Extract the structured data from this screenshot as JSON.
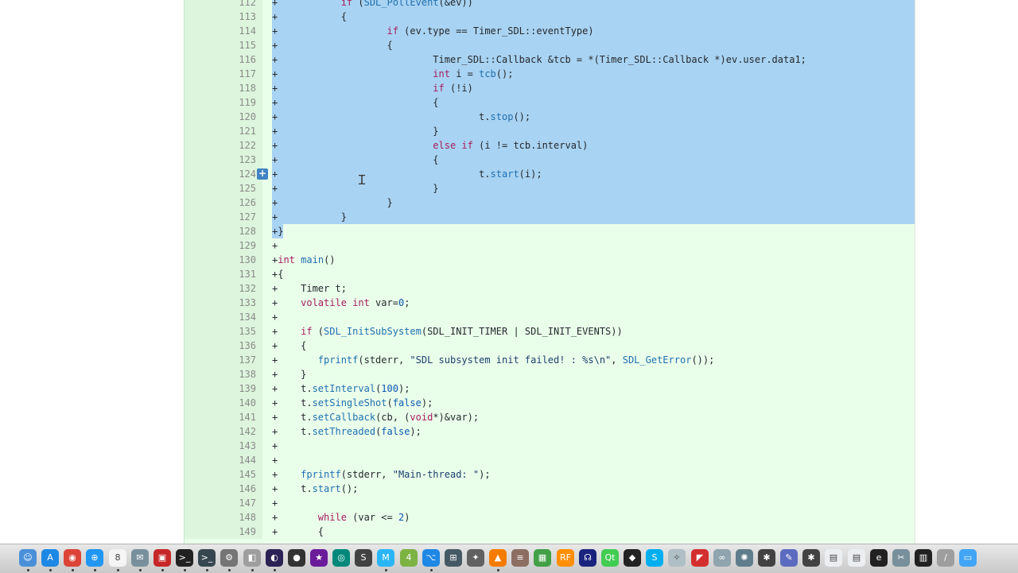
{
  "diff": {
    "lines": [
      {
        "n": "112",
        "sel": true,
        "t": [
          [
            "+           "
          ],
          [
            "if",
            "kw"
          ],
          [
            " ("
          ],
          [
            "SDL_PollEvent",
            "fn"
          ],
          [
            "(&ev))"
          ]
        ]
      },
      {
        "n": "113",
        "sel": true,
        "t": [
          [
            "+           {"
          ]
        ]
      },
      {
        "n": "114",
        "sel": true,
        "t": [
          [
            "+                   "
          ],
          [
            "if",
            "kw"
          ],
          [
            " (ev.type == Timer_SDL::eventType)"
          ]
        ]
      },
      {
        "n": "115",
        "sel": true,
        "t": [
          [
            "+                   {"
          ]
        ]
      },
      {
        "n": "116",
        "sel": true,
        "t": [
          [
            "+                           Timer_SDL::Callback &tcb = *(Timer_SDL::Callback *)ev.user.data1;"
          ]
        ]
      },
      {
        "n": "117",
        "sel": true,
        "t": [
          [
            "+                           "
          ],
          [
            "int",
            "kw"
          ],
          [
            " i = "
          ],
          [
            "tcb",
            "fn"
          ],
          [
            "();"
          ]
        ]
      },
      {
        "n": "118",
        "sel": true,
        "t": [
          [
            "+                           "
          ],
          [
            "if",
            "kw"
          ],
          [
            " (!i)"
          ]
        ]
      },
      {
        "n": "119",
        "sel": true,
        "t": [
          [
            "+                           {"
          ]
        ]
      },
      {
        "n": "120",
        "sel": true,
        "t": [
          [
            "+                                   t."
          ],
          [
            "stop",
            "fn"
          ],
          [
            "();"
          ]
        ]
      },
      {
        "n": "121",
        "sel": true,
        "t": [
          [
            "+                           }"
          ]
        ]
      },
      {
        "n": "122",
        "sel": true,
        "t": [
          [
            "+                           "
          ],
          [
            "else if",
            "kw"
          ],
          [
            " (i != tcb.interval)"
          ]
        ]
      },
      {
        "n": "123",
        "sel": true,
        "t": [
          [
            "+                           {"
          ]
        ]
      },
      {
        "n": "124",
        "sel": true,
        "btn": true,
        "t": [
          [
            "+                                   t."
          ],
          [
            "start",
            "fn"
          ],
          [
            "(i);"
          ]
        ]
      },
      {
        "n": "125",
        "sel": true,
        "t": [
          [
            "+                           }"
          ]
        ]
      },
      {
        "n": "126",
        "sel": true,
        "t": [
          [
            "+                   }"
          ]
        ]
      },
      {
        "n": "127",
        "sel": true,
        "t": [
          [
            "+           }"
          ]
        ]
      },
      {
        "n": "128",
        "partial": true,
        "t": [
          [
            "+}"
          ]
        ]
      },
      {
        "n": "129",
        "t": [
          [
            "+"
          ]
        ]
      },
      {
        "n": "130",
        "t": [
          [
            "+"
          ],
          [
            "int",
            "kw"
          ],
          [
            " "
          ],
          [
            "main",
            "fn"
          ],
          [
            "()"
          ]
        ]
      },
      {
        "n": "131",
        "t": [
          [
            "+{"
          ]
        ]
      },
      {
        "n": "132",
        "t": [
          [
            "+    Timer t;"
          ]
        ]
      },
      {
        "n": "133",
        "t": [
          [
            "+    "
          ],
          [
            "volatile int",
            "kw"
          ],
          [
            " var="
          ],
          [
            "0",
            "num"
          ],
          [
            ";"
          ]
        ]
      },
      {
        "n": "134",
        "t": [
          [
            "+"
          ]
        ]
      },
      {
        "n": "135",
        "t": [
          [
            "+    "
          ],
          [
            "if",
            "kw"
          ],
          [
            " ("
          ],
          [
            "SDL_InitSubSystem",
            "fn"
          ],
          [
            "(SDL_INIT_TIMER | SDL_INIT_EVENTS))"
          ]
        ]
      },
      {
        "n": "136",
        "t": [
          [
            "+    {"
          ]
        ]
      },
      {
        "n": "137",
        "t": [
          [
            "+       "
          ],
          [
            "fprintf",
            "fn"
          ],
          [
            "(stderr, "
          ],
          [
            "\"SDL subsystem init failed! : %s\\n\"",
            "str"
          ],
          [
            ", "
          ],
          [
            "SDL_GetError",
            "fn"
          ],
          [
            "());"
          ]
        ]
      },
      {
        "n": "138",
        "t": [
          [
            "+    }"
          ]
        ]
      },
      {
        "n": "139",
        "t": [
          [
            "+    t."
          ],
          [
            "setInterval",
            "fn"
          ],
          [
            "("
          ],
          [
            "100",
            "num"
          ],
          [
            ");"
          ]
        ]
      },
      {
        "n": "140",
        "t": [
          [
            "+    t."
          ],
          [
            "setSingleShot",
            "fn"
          ],
          [
            "("
          ],
          [
            "false",
            "num"
          ],
          [
            ");"
          ]
        ]
      },
      {
        "n": "141",
        "t": [
          [
            "+    t."
          ],
          [
            "setCallback",
            "fn"
          ],
          [
            "(cb, ("
          ],
          [
            "void",
            "kw"
          ],
          [
            "*)&var);"
          ]
        ]
      },
      {
        "n": "142",
        "t": [
          [
            "+    t."
          ],
          [
            "setThreaded",
            "fn"
          ],
          [
            "("
          ],
          [
            "false",
            "num"
          ],
          [
            ");"
          ]
        ]
      },
      {
        "n": "143",
        "t": [
          [
            "+"
          ]
        ]
      },
      {
        "n": "144",
        "t": [
          [
            "+"
          ]
        ]
      },
      {
        "n": "145",
        "t": [
          [
            "+    "
          ],
          [
            "fprintf",
            "fn"
          ],
          [
            "(stderr, "
          ],
          [
            "\"Main-thread: \"",
            "str"
          ],
          [
            ");"
          ]
        ]
      },
      {
        "n": "146",
        "t": [
          [
            "+    t."
          ],
          [
            "start",
            "fn"
          ],
          [
            "();"
          ]
        ]
      },
      {
        "n": "147",
        "t": [
          [
            "+"
          ]
        ]
      },
      {
        "n": "148",
        "t": [
          [
            "+       "
          ],
          [
            "while",
            "kw"
          ],
          [
            " (var <= "
          ],
          [
            "2",
            "num"
          ],
          [
            ")"
          ]
        ]
      },
      {
        "n": "149",
        "t": [
          [
            "+       {"
          ]
        ]
      }
    ]
  },
  "dock": {
    "apps": [
      {
        "name": "finder",
        "bg": "#4a90d9",
        "glyph": "☺"
      },
      {
        "name": "app-store",
        "bg": "#1e88e5",
        "glyph": "A"
      },
      {
        "name": "chrome",
        "bg": "#db4437",
        "glyph": "◉"
      },
      {
        "name": "safari",
        "bg": "#2196f3",
        "glyph": "⊕"
      },
      {
        "name": "calendar",
        "bg": "#f5f5f5",
        "glyph": "8"
      },
      {
        "name": "mail",
        "bg": "#78909c",
        "glyph": "✉"
      },
      {
        "name": "photo-booth",
        "bg": "#c62828",
        "glyph": "▣"
      },
      {
        "name": "terminal",
        "bg": "#212121",
        "glyph": ">_"
      },
      {
        "name": "terminal-2",
        "bg": "#37474f",
        "glyph": ">_"
      },
      {
        "name": "system-preferences",
        "bg": "#757575",
        "glyph": "⚙"
      },
      {
        "name": "preview",
        "bg": "#9e9e9e",
        "glyph": "◧"
      },
      {
        "name": "eclipse",
        "bg": "#2c2255",
        "glyph": "◐"
      },
      {
        "name": "github",
        "bg": "#333333",
        "glyph": "●"
      },
      {
        "name": "imovie",
        "bg": "#6a1b9a",
        "glyph": "★"
      },
      {
        "name": "cli-tool",
        "bg": "#00897b",
        "glyph": "◎"
      },
      {
        "name": "sublime",
        "bg": "#424242",
        "glyph": "S"
      },
      {
        "name": "m-app",
        "bg": "#29b6f6",
        "glyph": "M"
      },
      {
        "name": "android",
        "bg": "#7cb342",
        "glyph": "4"
      },
      {
        "name": "vs-code",
        "bg": "#1e88e5",
        "glyph": "⌥"
      },
      {
        "name": "bluetooth-app",
        "bg": "#455a64",
        "glyph": "⊞"
      },
      {
        "name": "final-cut",
        "bg": "#616161",
        "glyph": "✦"
      },
      {
        "name": "vlc",
        "bg": "#f57c00",
        "glyph": "▲"
      },
      {
        "name": "notes",
        "bg": "#8d6e63",
        "glyph": "≡"
      },
      {
        "name": "numbers",
        "bg": "#43a047",
        "glyph": "▦"
      },
      {
        "name": "rf-app",
        "bg": "#ff8f00",
        "glyph": "RF"
      },
      {
        "name": "headphones",
        "bg": "#1a237e",
        "glyph": "☊"
      },
      {
        "name": "qt-creator",
        "bg": "#41cd52",
        "glyph": "Qt"
      },
      {
        "name": "unity",
        "bg": "#222222",
        "glyph": "◆"
      },
      {
        "name": "skype",
        "bg": "#00aff0",
        "glyph": "S"
      },
      {
        "name": "compass",
        "bg": "#b0bec5",
        "glyph": "✧"
      },
      {
        "name": "red-app",
        "bg": "#d32f2f",
        "glyph": "◤"
      },
      {
        "name": "mysql-workbench",
        "bg": "#90a4ae",
        "glyph": "∞"
      },
      {
        "name": "satellite",
        "bg": "#607d8b",
        "glyph": "✺"
      },
      {
        "name": "spider",
        "bg": "#424242",
        "glyph": "✱"
      },
      {
        "name": "pen-tool",
        "bg": "#5c6bc0",
        "glyph": "✎"
      },
      {
        "name": "spider-2",
        "bg": "#424242",
        "glyph": "✱"
      },
      {
        "name": "document",
        "bg": "#eceff1",
        "glyph": "▤"
      },
      {
        "name": "document-2",
        "bg": "#eceff1",
        "glyph": "▤"
      },
      {
        "name": "e-app",
        "bg": "#212121",
        "glyph": "e"
      },
      {
        "name": "tools",
        "bg": "#78909c",
        "glyph": "✂"
      },
      {
        "name": "piano",
        "bg": "#212121",
        "glyph": "▥"
      },
      {
        "name": "brush",
        "bg": "#9e9e9e",
        "glyph": "/"
      },
      {
        "name": "folder",
        "bg": "#42a5f5",
        "glyph": "▭"
      }
    ]
  }
}
